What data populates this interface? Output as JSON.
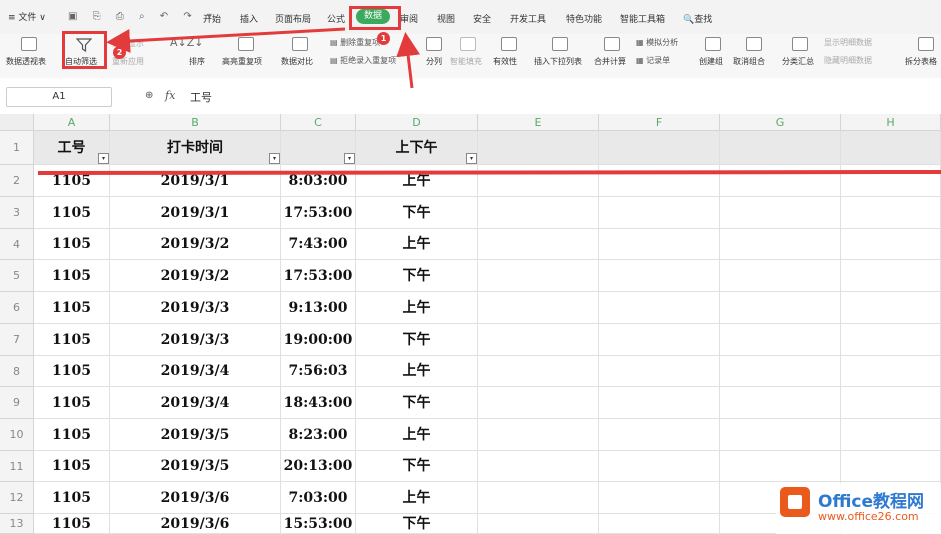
{
  "menu": {
    "file": "≡ 文件 ∨"
  },
  "tabs": [
    "开始",
    "插入",
    "页面布局",
    "公式",
    "数据",
    "审阅",
    "视图",
    "安全",
    "开发工具",
    "特色功能",
    "智能工具箱"
  ],
  "search_label": "🔍查找",
  "ribbon": {
    "pivot": "数据透视表",
    "autofilter": "自动筛选",
    "show_all": "全部显示",
    "reapply": "重新应用",
    "sort": "排序",
    "highlight_dup": "高亮重复项",
    "data_compare": "数据对比",
    "remove_dup": "删除重复项",
    "reject_dup": "拒绝录入重复项",
    "split": "分列",
    "smart_fill": "智能填充",
    "validity": "有效性",
    "insert_dropdown": "插入下拉列表",
    "consolidate": "合并计算",
    "simulate": "模拟分析",
    "record": "记录单",
    "group": "创建组",
    "ungroup": "取消组合",
    "subtotal": "分类汇总",
    "show_detail": "显示明细数据",
    "hide_detail": "隐藏明细数据",
    "split_table": "拆分表格"
  },
  "formula_bar": {
    "cell_ref": "A1",
    "fx": "fx",
    "content": "工号"
  },
  "columns": [
    "A",
    "B",
    "C",
    "D",
    "E",
    "F",
    "G",
    "H"
  ],
  "rows": [
    "1",
    "2",
    "3",
    "4",
    "5",
    "6",
    "7",
    "8",
    "9",
    "10",
    "11",
    "12",
    "13"
  ],
  "header": [
    "工号",
    "打卡时间",
    "",
    "上下午"
  ],
  "table": [
    [
      "1105",
      "2019/3/1",
      "8:03:00",
      "上午"
    ],
    [
      "1105",
      "2019/3/1",
      "17:53:00",
      "下午"
    ],
    [
      "1105",
      "2019/3/2",
      "7:43:00",
      "上午"
    ],
    [
      "1105",
      "2019/3/2",
      "17:53:00",
      "下午"
    ],
    [
      "1105",
      "2019/3/3",
      "9:13:00",
      "上午"
    ],
    [
      "1105",
      "2019/3/3",
      "19:00:00",
      "下午"
    ],
    [
      "1105",
      "2019/3/4",
      "7:56:03",
      "上午"
    ],
    [
      "1105",
      "2019/3/4",
      "18:43:00",
      "下午"
    ],
    [
      "1105",
      "2019/3/5",
      "8:23:00",
      "上午"
    ],
    [
      "1105",
      "2019/3/5",
      "20:13:00",
      "下午"
    ],
    [
      "1105",
      "2019/3/6",
      "7:03:00",
      "上午"
    ],
    [
      "1105",
      "2019/3/6",
      "15:53:00",
      "下午"
    ]
  ],
  "annotations": {
    "badge1": "1",
    "badge2": "2"
  },
  "watermark": {
    "title": "Office教程网",
    "url": "www.office26.com"
  },
  "colors": {
    "accent": "#3aaa5e",
    "annotation_red": "#e33b3b",
    "watermark_blue": "#2f7ad1",
    "watermark_orange": "#e95a1c"
  }
}
